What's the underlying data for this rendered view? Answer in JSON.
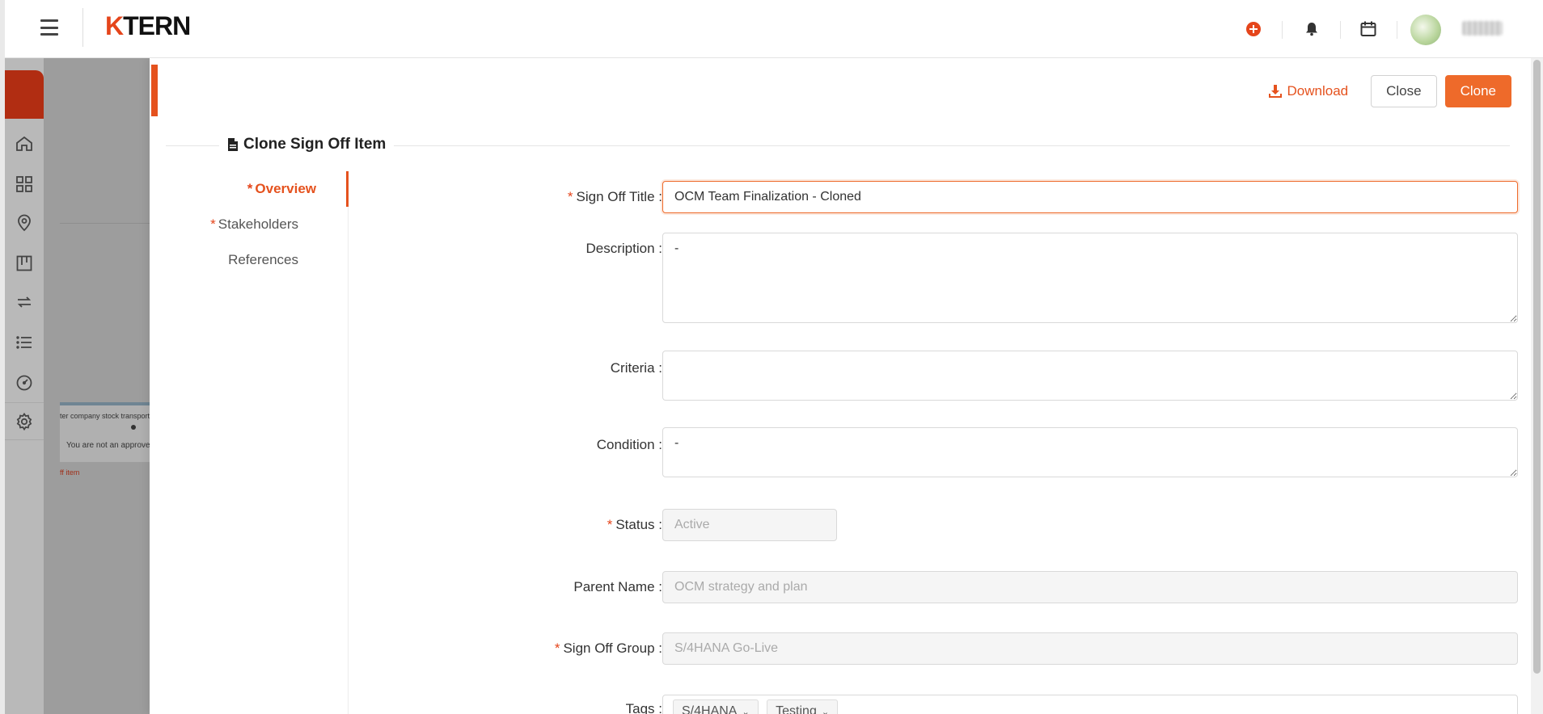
{
  "header": {
    "logo_k": "K",
    "logo_rest": "TERN",
    "icons": [
      "menu-icon",
      "add-circle-icon",
      "bell-icon",
      "calendar-icon"
    ],
    "accent_color": "#e5521e"
  },
  "background_page": {
    "card_text": "ter company stock transport",
    "card_note": "You are not an approve",
    "link_text": "ff item"
  },
  "sidebar": {
    "items": [
      "home-icon",
      "grid-icon",
      "location-icon",
      "board-icon",
      "transfer-icon",
      "list-icon",
      "dashboard-icon",
      "settings-icon"
    ]
  },
  "drawer": {
    "actions": {
      "download_label": "Download",
      "close_label": "Close",
      "clone_label": "Clone"
    },
    "title": "Clone Sign Off Item",
    "nav": {
      "overview": "Overview",
      "stakeholders": "Stakeholders",
      "references": "References"
    },
    "form": {
      "sign_off_title": {
        "label": "Sign Off Title",
        "value": "OCM Team Finalization - Cloned"
      },
      "description": {
        "label": "Description",
        "value": "-"
      },
      "criteria": {
        "label": "Criteria",
        "value": ""
      },
      "condition": {
        "label": "Condition",
        "value": "-"
      },
      "status": {
        "label": "Status",
        "value": "Active"
      },
      "parent_name": {
        "label": "Parent Name",
        "value": "OCM strategy and plan"
      },
      "sign_off_group": {
        "label": "Sign Off Group",
        "value": "S/4HANA Go-Live"
      },
      "tags": {
        "label": "Tags",
        "values": [
          "S/4HANA",
          "Testing"
        ]
      }
    }
  }
}
